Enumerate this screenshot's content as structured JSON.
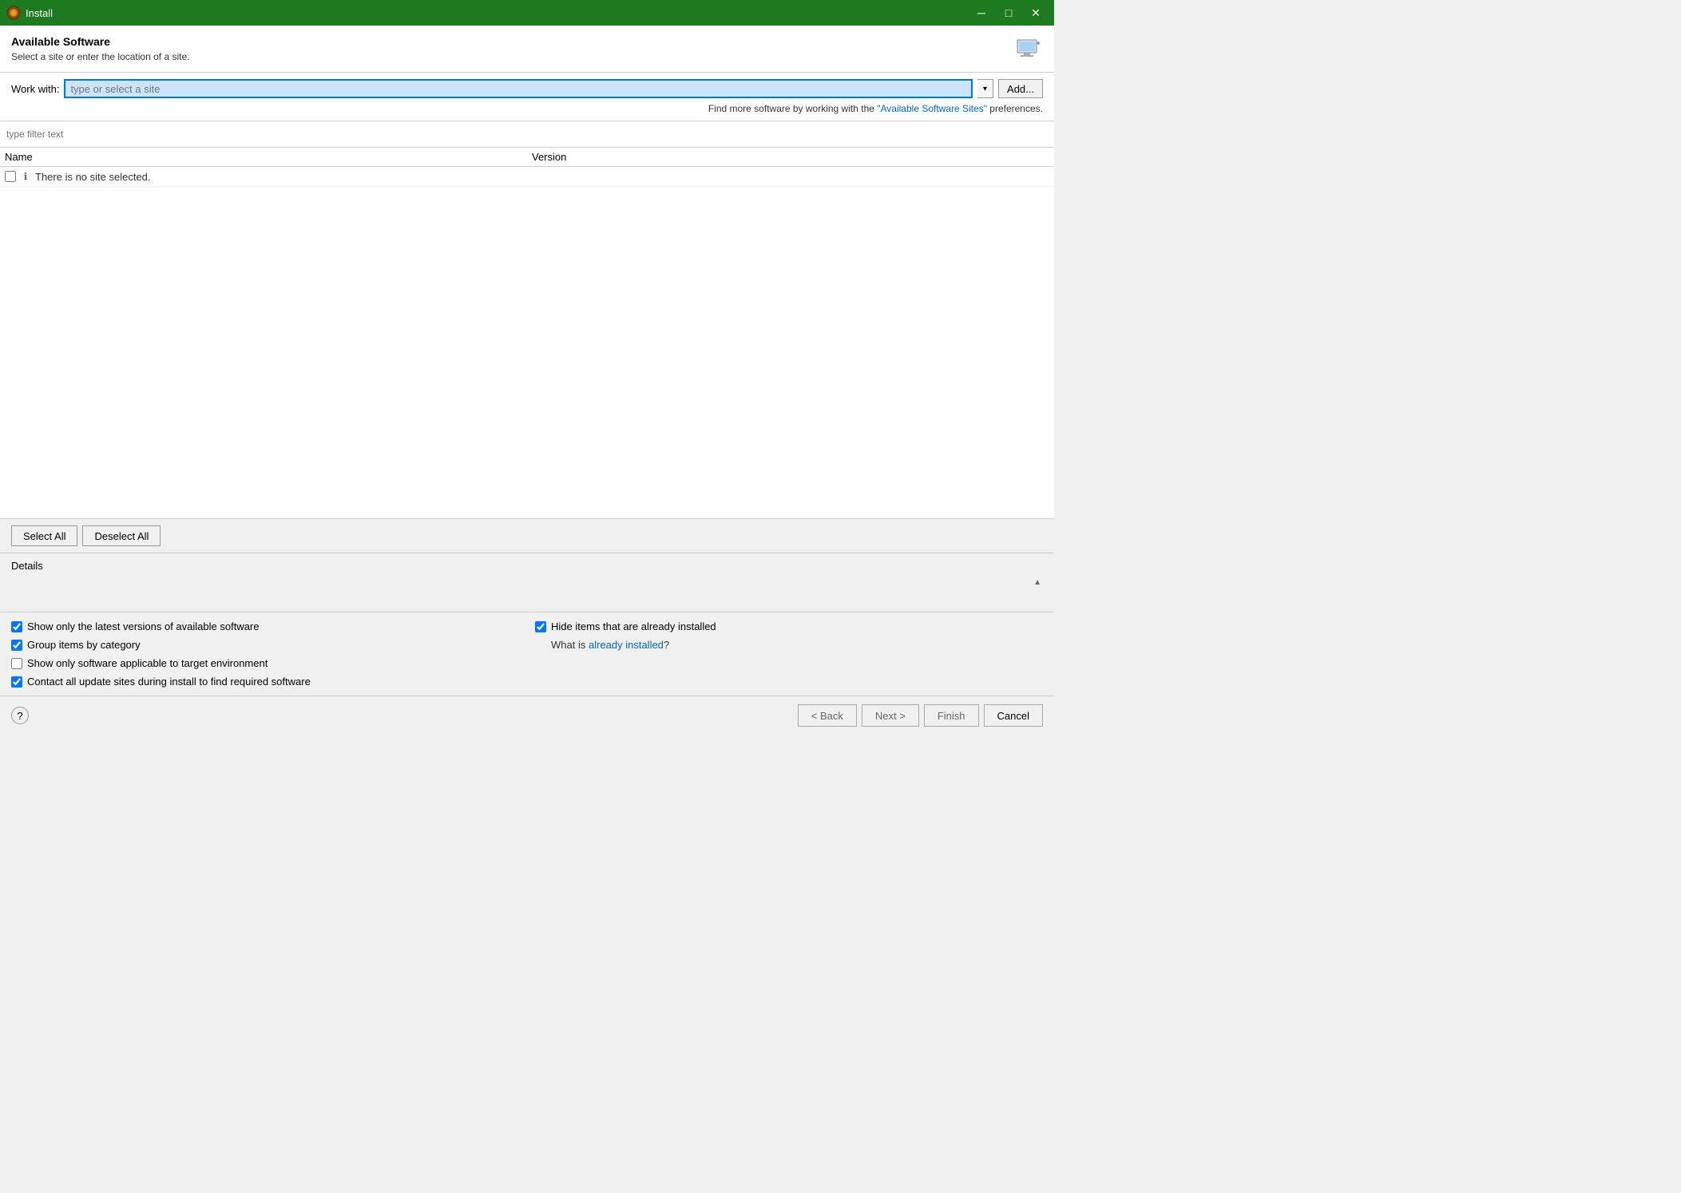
{
  "titleBar": {
    "title": "Install",
    "iconLabel": "install-icon",
    "minimizeLabel": "─",
    "maximizeLabel": "□",
    "closeLabel": "✕"
  },
  "header": {
    "title": "Available Software",
    "subtitle": "Select a site or enter the location of a site.",
    "iconLabel": "computer-icon"
  },
  "workWith": {
    "label": "Work with:",
    "inputPlaceholder": "type or select a site",
    "addButtonLabel": "Add...",
    "findMoreText": "Find more software by working with the ",
    "findMoreLinkText": "\"Available Software Sites\"",
    "findMoreSuffix": " preferences."
  },
  "filter": {
    "placeholder": "type filter text"
  },
  "table": {
    "colName": "Name",
    "colVersion": "Version",
    "noSiteRow": {
      "checkboxChecked": false,
      "icon": "ℹ",
      "label": "There is no site selected."
    }
  },
  "buttons": {
    "selectAll": "Select All",
    "deselectAll": "Deselect All"
  },
  "details": {
    "label": "Details"
  },
  "checkboxes": {
    "left": [
      {
        "id": "cb1",
        "label": "Show only the latest versions of available software",
        "checked": true
      },
      {
        "id": "cb2",
        "label": "Group items by category",
        "checked": true
      },
      {
        "id": "cb3",
        "label": "Show only software applicable to target environment",
        "checked": false
      },
      {
        "id": "cb4",
        "label": "Contact all update sites during install to find required software",
        "checked": true
      }
    ],
    "right": [
      {
        "id": "cb5",
        "label": "Hide items that are already installed",
        "checked": true
      }
    ],
    "whatIsText": "What is ",
    "whatIsLinkText": "already installed",
    "whatIsSuffix": "?"
  },
  "bottomNav": {
    "helpLabel": "?",
    "backLabel": "< Back",
    "nextLabel": "Next >",
    "finishLabel": "Finish",
    "cancelLabel": "Cancel"
  }
}
